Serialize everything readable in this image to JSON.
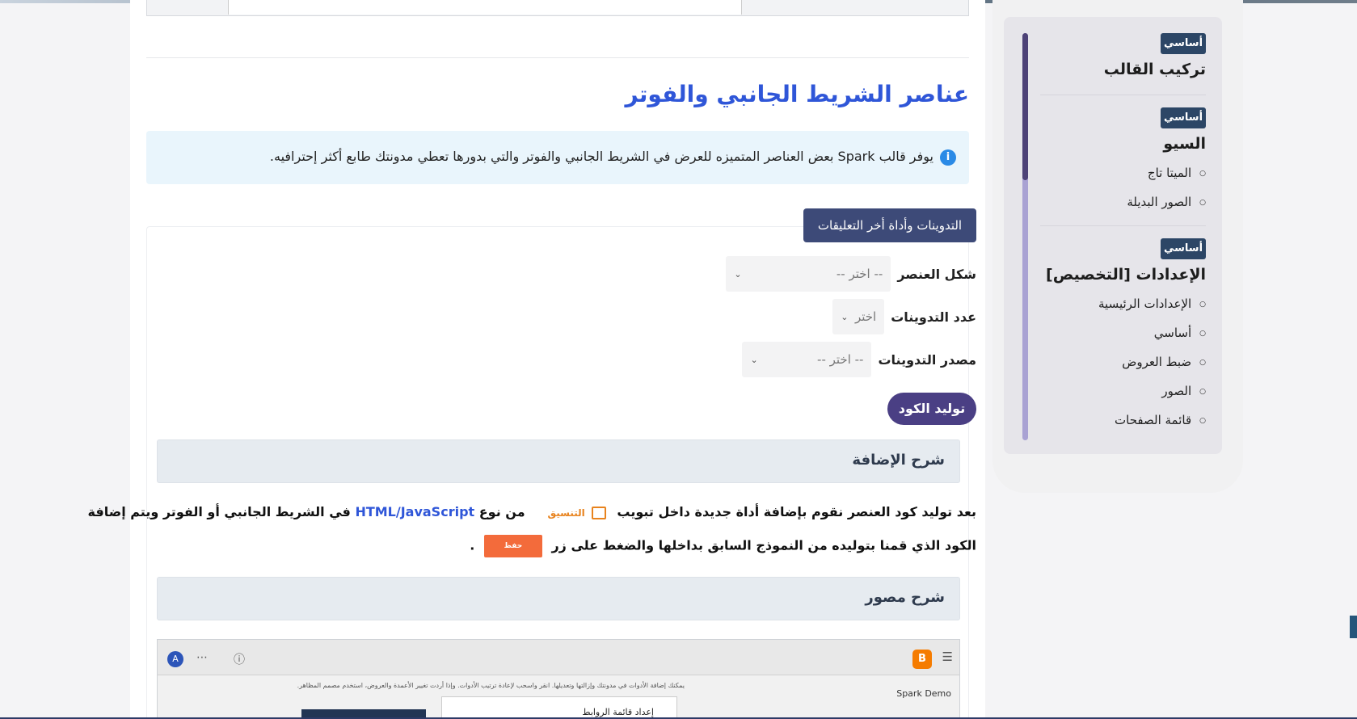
{
  "article": {
    "heading": "عناصر الشريط الجانبي والفوتر",
    "info_text": "يوفر قالب Spark بعض العناصر المتميزه للعرض في الشريط الجانبي والفوتر والتي بدورها تعطي مدونتك طابع أكثر إحترافيه.",
    "tab_label": "التدوينات وأداة أخر التعليقات",
    "fields": {
      "shape_label": "شكل العنصر",
      "shape_value": "-- اختر --",
      "count_label": "عدد التدوينات",
      "count_value": "اختر",
      "source_label": "مصدر التدوينات",
      "source_value": "-- اختر --"
    },
    "generate_button": "توليد الكود",
    "explain_header": "شرح الإضافة",
    "explain_line1_a": "بعد توليد كود العنصر نقوم بإضافة أداة جديدة داخل تبويب",
    "explain_line1_tab": "التنسيق",
    "explain_line1_b": "من نوع",
    "explain_line1_link": "HTML/JavaScript",
    "explain_line1_c": "في الشريط الجانبي أو الفوتر ويتم إضافة",
    "explain_line2_a": "الكود الذي قمنا بتوليده من النموذج السابق بداخلها والضغط على زر",
    "explain_line2_save": "حفظ",
    "explain_line2_end": ".",
    "visual_header": "شرح مصور",
    "screenshot": {
      "avatar_letter": "A",
      "note": "يمكنك إضافة الأدوات في مدونتك وإزالتها وتعديلها. انقر واسحب لإعادة ترتيب الأدوات. وإذا أردت تغيير الأعمدة والعروض، استخدم مصمم المظاهر.",
      "blog_name": "Spark Demo",
      "popup_text": "إعداد قائمة الروابط"
    }
  },
  "sidebar": {
    "badge": "أساسي",
    "sections": [
      {
        "title": "تركيب القالب",
        "items": []
      },
      {
        "title": "السيو",
        "items": [
          "الميتا تاج",
          "الصور البديلة"
        ]
      },
      {
        "title": "الإعدادات [التخصيص]",
        "items": [
          "الإعدادات الرئيسية",
          "أساسي",
          "ضبط العروض",
          "الصور",
          "قائمة الصفحات"
        ]
      }
    ]
  }
}
